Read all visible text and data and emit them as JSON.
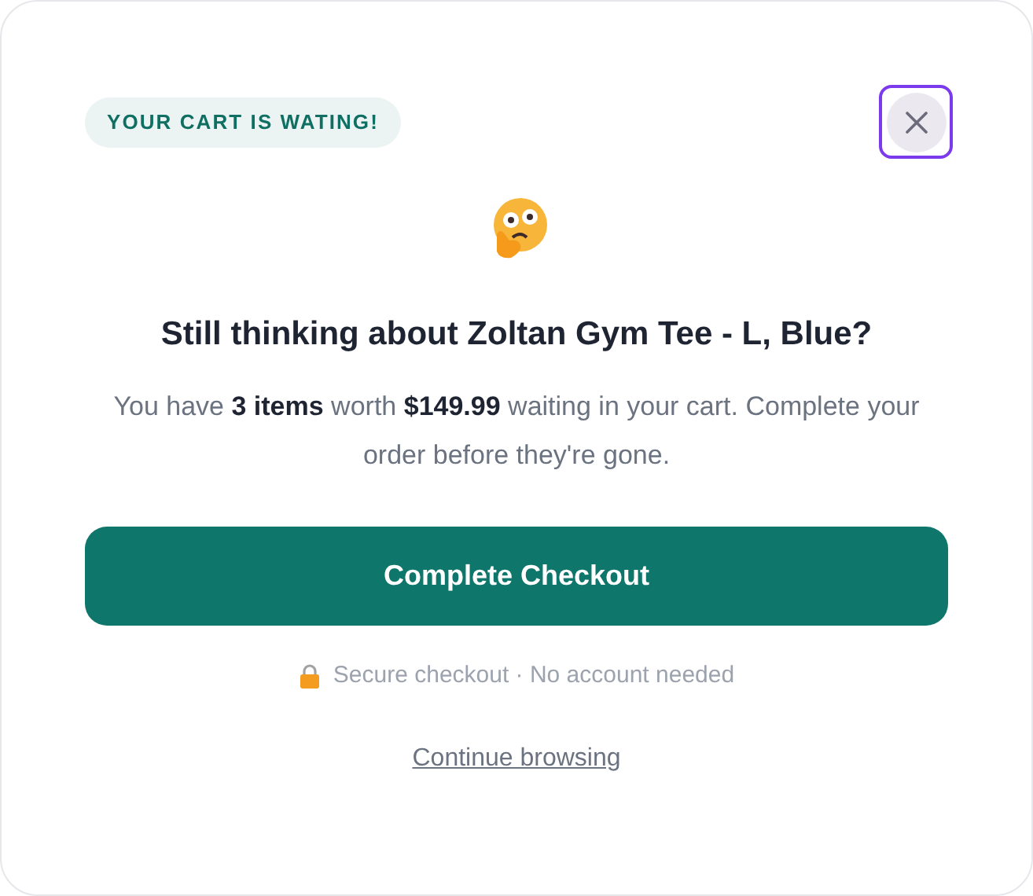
{
  "badge": "YOUR CART IS WATING!",
  "close_button": {
    "focused": true
  },
  "title": "Still thinking about Zoltan Gym Tee - L, Blue?",
  "message": "You have **3 items** worth **$149.99** waiting in your cart. Complete your order before they're gone.",
  "primary_button": "Complete Checkout",
  "security_note": "Secure checkout · No account needed",
  "secondary_link": "Continue browsing"
}
